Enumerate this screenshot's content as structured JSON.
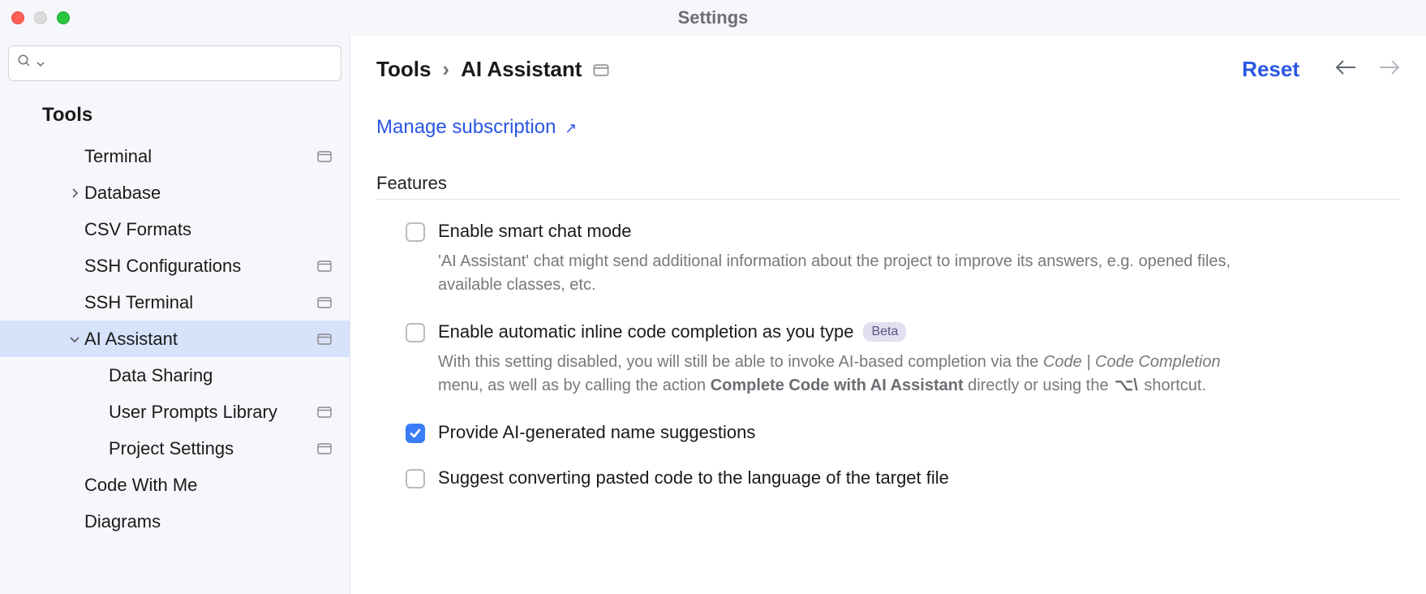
{
  "window": {
    "title": "Settings"
  },
  "search": {
    "placeholder": ""
  },
  "sidebar": {
    "section": "Tools",
    "items": [
      {
        "label": "Terminal",
        "indent": 2,
        "arrow": "",
        "badge": true,
        "selected": false
      },
      {
        "label": "Database",
        "indent": 2,
        "arrow": "right",
        "badge": false,
        "selected": false
      },
      {
        "label": "CSV Formats",
        "indent": 2,
        "arrow": "",
        "badge": false,
        "selected": false
      },
      {
        "label": "SSH Configurations",
        "indent": 2,
        "arrow": "",
        "badge": true,
        "selected": false
      },
      {
        "label": "SSH Terminal",
        "indent": 2,
        "arrow": "",
        "badge": true,
        "selected": false
      },
      {
        "label": "AI Assistant",
        "indent": 2,
        "arrow": "down",
        "badge": true,
        "selected": true
      },
      {
        "label": "Data Sharing",
        "indent": 3,
        "arrow": "",
        "badge": false,
        "selected": false
      },
      {
        "label": "User Prompts Library",
        "indent": 3,
        "arrow": "",
        "badge": true,
        "selected": false
      },
      {
        "label": "Project Settings",
        "indent": 3,
        "arrow": "",
        "badge": true,
        "selected": false
      },
      {
        "label": "Code With Me",
        "indent": 2,
        "arrow": "",
        "badge": false,
        "selected": false
      },
      {
        "label": "Diagrams",
        "indent": 2,
        "arrow": "",
        "badge": false,
        "selected": false
      }
    ]
  },
  "breadcrumb": {
    "root": "Tools",
    "leaf": "AI Assistant",
    "sep": "›"
  },
  "reset_label": "Reset",
  "manage_subscription_label": "Manage subscription",
  "features_title": "Features",
  "options": {
    "smart_chat": {
      "title": "Enable smart chat mode",
      "desc_plain": "'AI Assistant' chat might send additional information about the project to improve its answers, e.g. opened files, available classes, etc.",
      "checked": false
    },
    "inline_completion": {
      "title": "Enable automatic inline code completion as you type",
      "beta": "Beta",
      "desc_pre": "With this setting disabled, you will still be able to invoke AI-based completion via the ",
      "desc_menu": "Code | Code Completion",
      "desc_mid": " menu, as well as by calling the action ",
      "desc_action": "Complete Code with AI Assistant",
      "desc_post1": " directly or using the ",
      "shortcut": "⌥\\",
      "desc_post2": " shortcut.",
      "checked": false
    },
    "name_suggestions": {
      "title": "Provide AI-generated name suggestions",
      "checked": true
    },
    "convert_pasted": {
      "title": "Suggest converting pasted code to the language of the target file",
      "checked": false
    }
  }
}
